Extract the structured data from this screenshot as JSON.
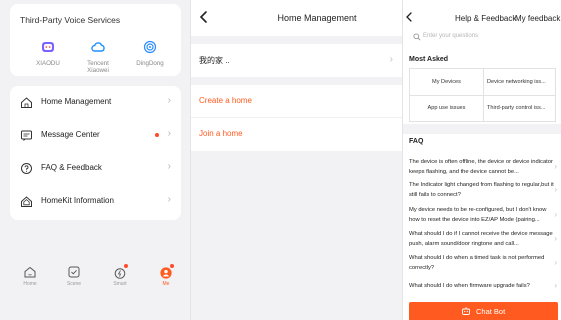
{
  "voice_services": {
    "title": "Third-Party Voice Services",
    "items": [
      {
        "label": "XIAODU",
        "icon": "xiaodu-icon",
        "color": "#7b61ff"
      },
      {
        "label": "Tencent\nXiaowei",
        "icon": "tencent-xiaowei-icon",
        "color": "#1e90ff"
      },
      {
        "label": "DingDong",
        "icon": "dingdong-icon",
        "color": "#2b8cff"
      }
    ]
  },
  "menu": {
    "items": [
      {
        "label": "Home Management",
        "icon": "home-icon"
      },
      {
        "label": "Message Center",
        "icon": "message-icon",
        "has_dot": true
      },
      {
        "label": "FAQ & Feedback",
        "icon": "help-icon"
      },
      {
        "label": "HomeKit Information",
        "icon": "homekit-icon"
      }
    ]
  },
  "tabbar": {
    "tabs": [
      {
        "label": "Home",
        "icon": "home-tab-icon",
        "active": false
      },
      {
        "label": "Scene",
        "icon": "scene-tab-icon",
        "active": false
      },
      {
        "label": "Smart",
        "icon": "smart-tab-icon",
        "active": false
      },
      {
        "label": "Me",
        "icon": "me-tab-icon",
        "active": true
      }
    ],
    "active_color": "#ff5a1f"
  },
  "home_management": {
    "title": "Home Management",
    "home_name": "我的家 ..",
    "create_label": "Create a home",
    "join_label": "Join a home",
    "accent": "#ff5a1f"
  },
  "help": {
    "title": "Help & Feedback",
    "my_feedback": "My feedback",
    "search_placeholder": "Enter your questions",
    "most_asked_title": "Most Asked",
    "most_asked": [
      "My Devices",
      "Device networking iss...",
      "App use issues",
      "Third-party control iss..."
    ],
    "faq_title": "FAQ",
    "faq": [
      "The device is often offline, the device or device indicator keeps flashing, and the device cannot be...",
      "The Indicator light changed from flashing to regular,but it still fails to connect?",
      "My device needs to be re-configured, but I don't know how to reset the device into EZ/AP Mode (pairing...",
      "What should I do if I cannot receive the device message push, alarm sound/door ringtone and call...",
      "What should I do when a timed task is not performed correctly?",
      "What should I do when firmware upgrade fails?"
    ],
    "chat_label": "Chat Bot",
    "accent": "#ff5a1f"
  }
}
